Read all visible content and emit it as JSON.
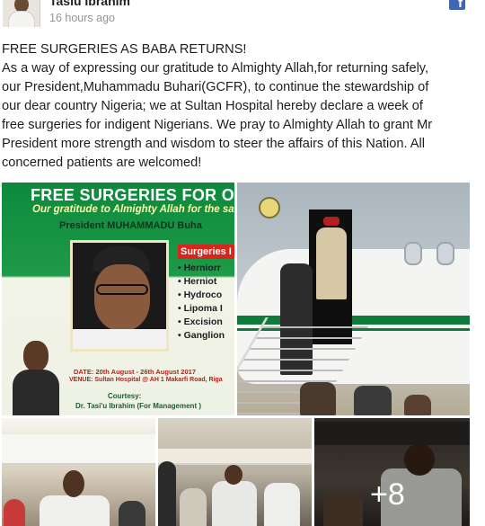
{
  "post": {
    "author": "Tasiu Ibrahim",
    "timestamp": "16 hours ago",
    "platform_icon": "facebook-icon",
    "text_lines": [
      "FREE SURGERIES AS BABA RETURNS!",
      "As a way of expressing our gratitude to Almighty Allah,for returning safely,",
      "our President,Muhammadu Buhari(GCFR), to continue the stewardship of",
      "our dear country Nigeria; we at Sultan Hospital hereby declare a week of",
      "free surgeries for indigent Nigerians. We pray to Almighty Allah to grant Mr",
      "President more strength and wisdom to steer the affairs of this Nation. All",
      "concerned patients are welcomed!"
    ]
  },
  "photos": {
    "poster": {
      "title": "FREE SURGERIES FOR O",
      "subtitle": "Our gratitude to Almighty Allah for the sa",
      "president": "President MUHAMMADU Buha",
      "surgeries_heading": "Surgeries I",
      "surgeries": [
        "• Herniorr",
        "• Herniot",
        "• Hydroco",
        "• Lipoma I",
        "• Excision",
        "• Ganglion"
      ],
      "date": "DATE: 20th August - 26th August 2017",
      "venue": "VENUE: Sultan Hospital @ AH 1 Makarfi Road, Riga",
      "courtesy": "Courtesy:",
      "credit": "Dr. Tasi'u Ibrahim (For Management )"
    },
    "more_count": "+8"
  },
  "colors": {
    "text": "#1c1e21",
    "timestamp": "#90949c",
    "facebook_blue": "#4267b2",
    "poster_green": "#0c8a3c",
    "poster_red": "#d9261c",
    "plane_stripe": "#0f7a3c"
  }
}
